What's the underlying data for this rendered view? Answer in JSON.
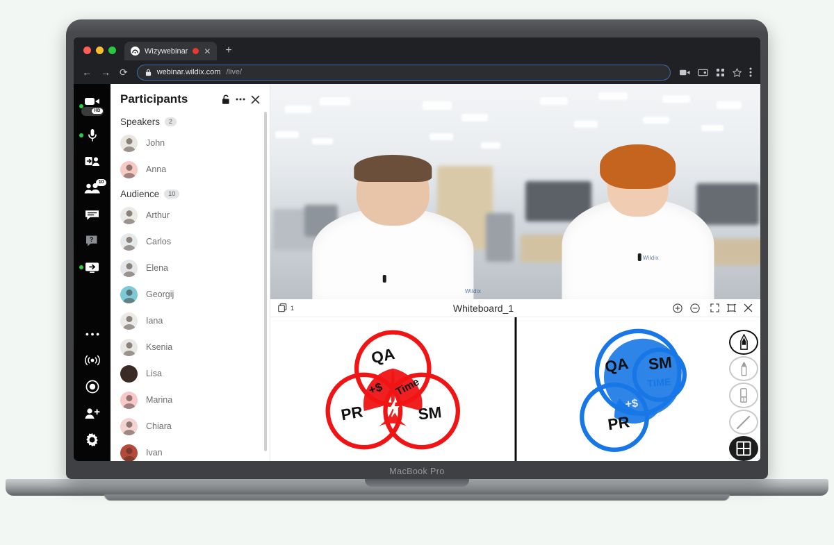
{
  "device": {
    "label": "MacBook Pro"
  },
  "browser": {
    "tab": {
      "title": "Wizywebinar",
      "favicon_icon": "wizy-logo-icon",
      "recording_icon": "recording-dot-icon",
      "close_icon": "close-icon"
    },
    "new_tab_label": "+",
    "nav": {
      "back_icon": "arrow-left-icon",
      "forward_icon": "arrow-right-icon",
      "reload_icon": "reload-icon",
      "lock_icon": "lock-icon",
      "url_host": "webinar.wildix.com",
      "url_path": "/live/",
      "camera_icon": "camera-icon",
      "screenshare_icon": "screen-share-icon",
      "extensions_icon": "extensions-grid-icon",
      "bookmark_icon": "star-icon",
      "menu_icon": "kebab-menu-icon"
    }
  },
  "rail": {
    "items": [
      {
        "name": "camera-toggle",
        "icon": "video-camera-icon",
        "active": true,
        "hd_label": "HD"
      },
      {
        "name": "microphone-toggle",
        "icon": "microphone-icon",
        "active": true
      },
      {
        "name": "invite-participant",
        "icon": "person-add-box-icon",
        "active": false
      },
      {
        "name": "participants-panel",
        "icon": "people-icon",
        "active": false,
        "badge": "10"
      },
      {
        "name": "chat-panel",
        "icon": "chat-bubble-icon",
        "active": false
      },
      {
        "name": "qa-panel",
        "icon": "question-bubble-icon",
        "active": false
      },
      {
        "name": "screen-share",
        "icon": "screen-share-icon",
        "active": true
      },
      {
        "name": "more-options",
        "icon": "ellipsis-icon",
        "active": false
      },
      {
        "name": "broadcast",
        "icon": "broadcast-icon",
        "active": false
      },
      {
        "name": "record",
        "icon": "record-circle-icon",
        "active": false
      },
      {
        "name": "add-user",
        "icon": "person-plus-icon",
        "active": false
      },
      {
        "name": "settings",
        "icon": "gear-icon",
        "active": false
      }
    ]
  },
  "participants": {
    "title": "Participants",
    "lock_icon": "unlocked-padlock-icon",
    "more_icon": "ellipsis-icon",
    "close_icon": "close-icon",
    "groups": [
      {
        "label": "Speakers",
        "count": "2",
        "people": [
          {
            "name": "John",
            "color": "#e9e6e2"
          },
          {
            "name": "Anna",
            "color": "#f6c9c5"
          }
        ]
      },
      {
        "label": "Audience",
        "count": "10",
        "people": [
          {
            "name": "Arthur",
            "color": "#eceae6"
          },
          {
            "name": "Carlos",
            "color": "#e6e9ea"
          },
          {
            "name": "Elena",
            "color": "#e4e6e9"
          },
          {
            "name": "Georgij",
            "color": "#7ec9d8"
          },
          {
            "name": "Iana",
            "color": "#eceae7"
          },
          {
            "name": "Ksenia",
            "color": "#eae8e5"
          },
          {
            "name": "Lisa",
            "color": "#3a2a26"
          },
          {
            "name": "Marina",
            "color": "#f7c7c9"
          },
          {
            "name": "Chiara",
            "color": "#f3d4d2"
          },
          {
            "name": "Ivan",
            "color": "#b5493a"
          }
        ]
      }
    ]
  },
  "videos": [
    {
      "name": "speaker-tile-john",
      "speaking": true,
      "brand": "Wildix"
    },
    {
      "name": "speaker-tile-anna",
      "speaking": false,
      "brand": "Wildix"
    }
  ],
  "whiteboard": {
    "title": "Whiteboard_1",
    "page_icon": "pages-icon",
    "page_number": "1",
    "zoom_in_icon": "zoom-in-icon",
    "zoom_out_icon": "zoom-out-icon",
    "fullscreen_icon": "fullscreen-icon",
    "fit_icon": "fit-screen-icon",
    "close_icon": "close-icon",
    "collapse_icon": "chevron-right-icon",
    "tools": [
      {
        "name": "pen-tool",
        "icon": "pen-icon",
        "state": "outlined"
      },
      {
        "name": "marker-tool",
        "icon": "marker-icon",
        "state": "normal"
      },
      {
        "name": "eraser-tool",
        "icon": "eraser-icon",
        "state": "normal"
      },
      {
        "name": "line-tool",
        "icon": "line-icon",
        "state": "normal"
      },
      {
        "name": "grid-tool",
        "icon": "grid-icon",
        "state": "filled"
      }
    ],
    "drawings": {
      "left": {
        "color": "#f01414",
        "type": "three-circle-venn",
        "labels": [
          "QA",
          "PR",
          "SM"
        ],
        "intersection_labels": [
          "+$",
          "Time"
        ],
        "center_glyph": "lightning-bolt"
      },
      "right": {
        "color": "#1877e6",
        "type": "nested-overlap-diagram",
        "labels": [
          "QA",
          "SM",
          "PR"
        ],
        "inner_labels": [
          "TIME"
        ],
        "intersection_labels": [
          "+$"
        ]
      }
    }
  }
}
